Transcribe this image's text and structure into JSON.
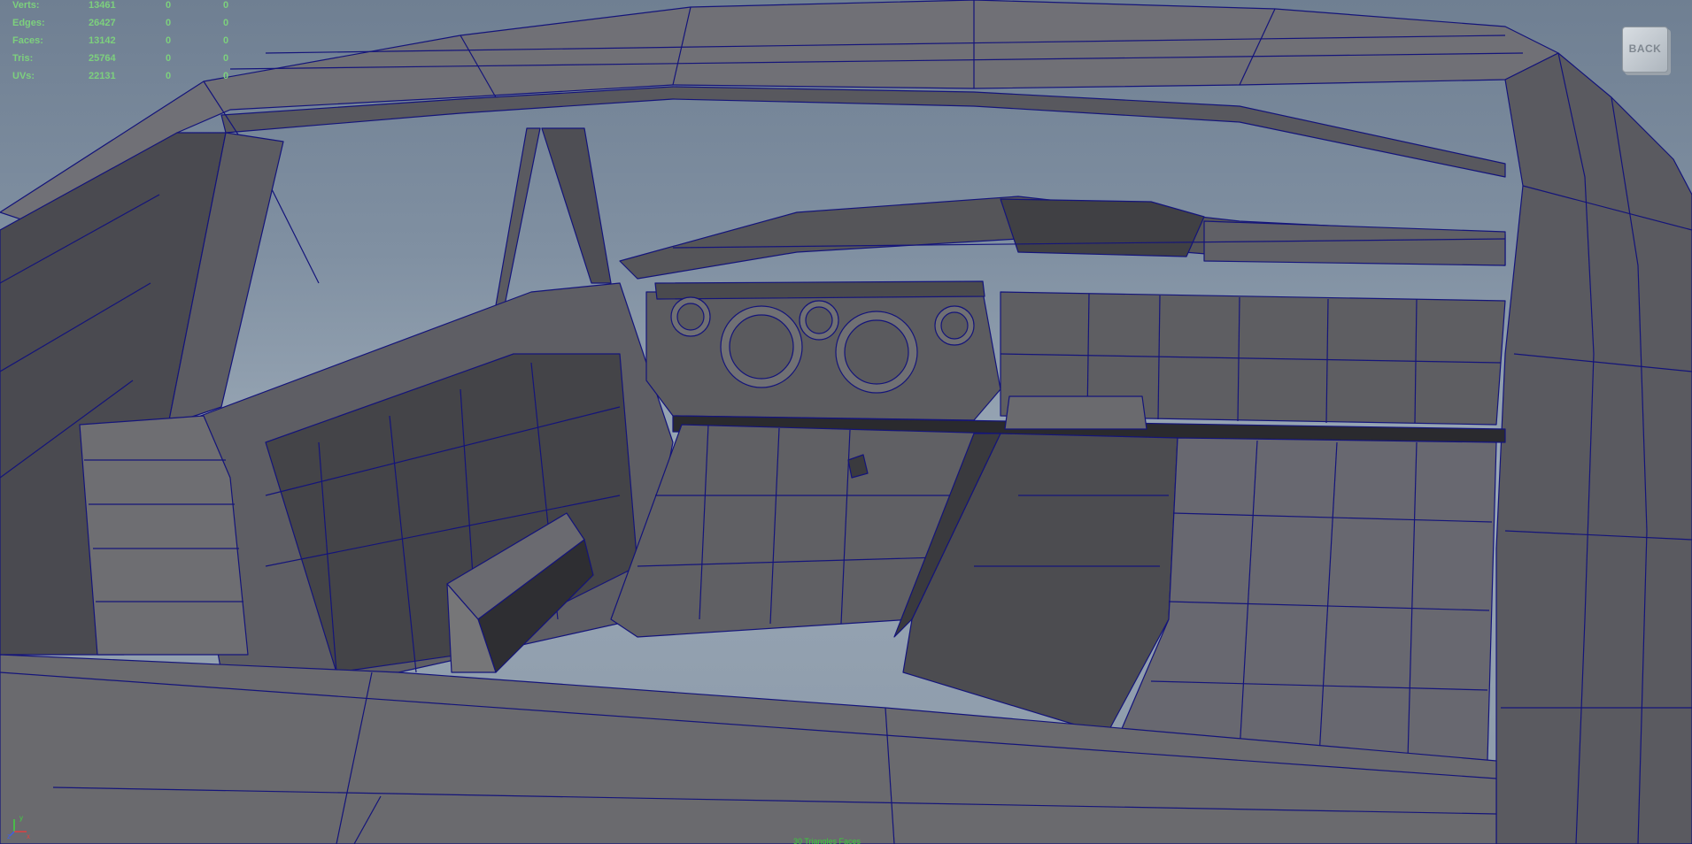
{
  "hud": {
    "rows": [
      {
        "label": "Verts:",
        "total": "13461",
        "sel1": "0",
        "sel2": "0"
      },
      {
        "label": "Edges:",
        "total": "26427",
        "sel1": "0",
        "sel2": "0"
      },
      {
        "label": "Faces:",
        "total": "13142",
        "sel1": "0",
        "sel2": "0"
      },
      {
        "label": "Tris:",
        "total": "25764",
        "sel1": "0",
        "sel2": "0"
      },
      {
        "label": "UVs:",
        "total": "22131",
        "sel1": "0",
        "sel2": "0"
      }
    ]
  },
  "viewcube": {
    "label": "BACK"
  },
  "axis": {
    "x": "x",
    "y": "y",
    "z": "z"
  },
  "bottom_label": "30 Triangles Faces",
  "colors": {
    "hud_text": "#7dd07d",
    "wireframe": "#14147a",
    "mesh_light": "#6a6a6e",
    "mesh_dark": "#3e3e42",
    "background_top": "#6f7f92",
    "background_mid": "#9aa8b6"
  },
  "icons": [
    "view-cube-icon",
    "axis-gizmo-icon"
  ]
}
